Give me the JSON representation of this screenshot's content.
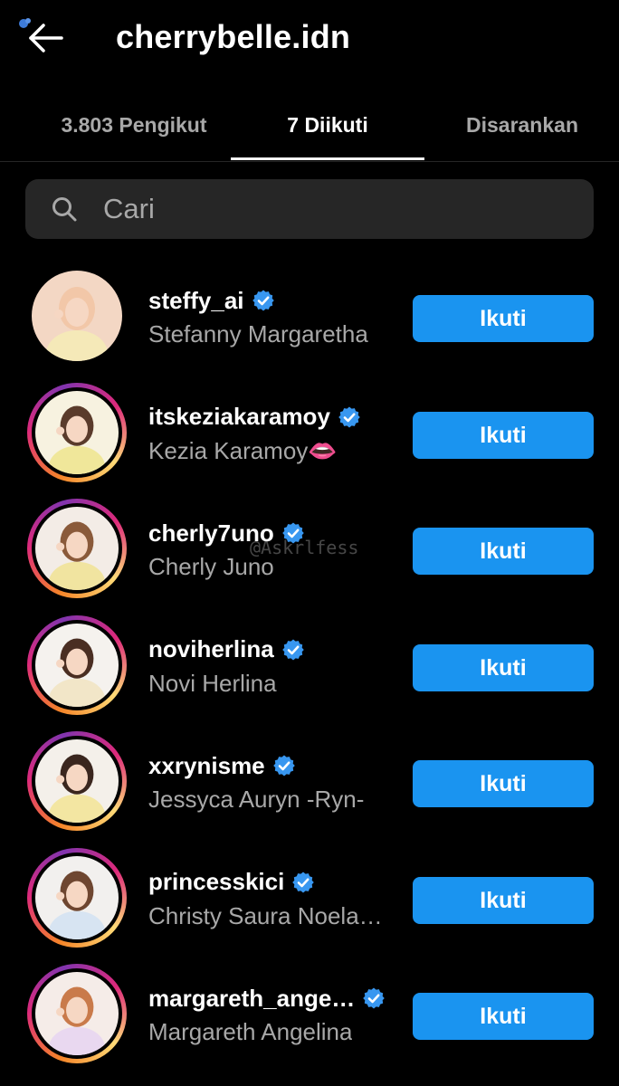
{
  "header": {
    "title": "cherrybelle.idn"
  },
  "tabs": [
    {
      "label": "3.803 Pengikut",
      "active": false
    },
    {
      "label": "7 Diikuti",
      "active": true
    },
    {
      "label": "Disarankan",
      "active": false
    }
  ],
  "search": {
    "placeholder": "Cari",
    "value": ""
  },
  "accounts": [
    {
      "username": "steffy_ai",
      "full_name": "Stefanny Margaretha",
      "verified": true,
      "story_ring": false,
      "button": "Ikuti"
    },
    {
      "username": "itskeziakaramoy",
      "full_name": "Kezia Karamoy👄",
      "verified": true,
      "story_ring": true,
      "button": "Ikuti"
    },
    {
      "username": "cherly7uno",
      "full_name": "Cherly Juno",
      "verified": true,
      "story_ring": true,
      "button": "Ikuti"
    },
    {
      "username": "noviherlina",
      "full_name": "Novi Herlina",
      "verified": true,
      "story_ring": true,
      "button": "Ikuti"
    },
    {
      "username": "xxrynisme",
      "full_name": "Jessyca Auryn -Ryn-",
      "verified": true,
      "story_ring": true,
      "button": "Ikuti"
    },
    {
      "username": "princesskici",
      "full_name": "Christy Saura Noela…",
      "verified": true,
      "story_ring": true,
      "button": "Ikuti"
    },
    {
      "username": "margareth_ange…",
      "full_name": "Margareth Angelina",
      "verified": true,
      "story_ring": true,
      "button": "Ikuti"
    }
  ],
  "watermark": "@Askrlfess",
  "colors": {
    "background": "#000000",
    "button": "#1a94f0",
    "verified_badge": "#3897f0",
    "secondary_text": "#a8a8a8",
    "search_bg": "#262626"
  },
  "icons": {
    "back": "arrow-left-icon",
    "search": "magnifier-icon",
    "verified": "verified-badge-icon"
  }
}
